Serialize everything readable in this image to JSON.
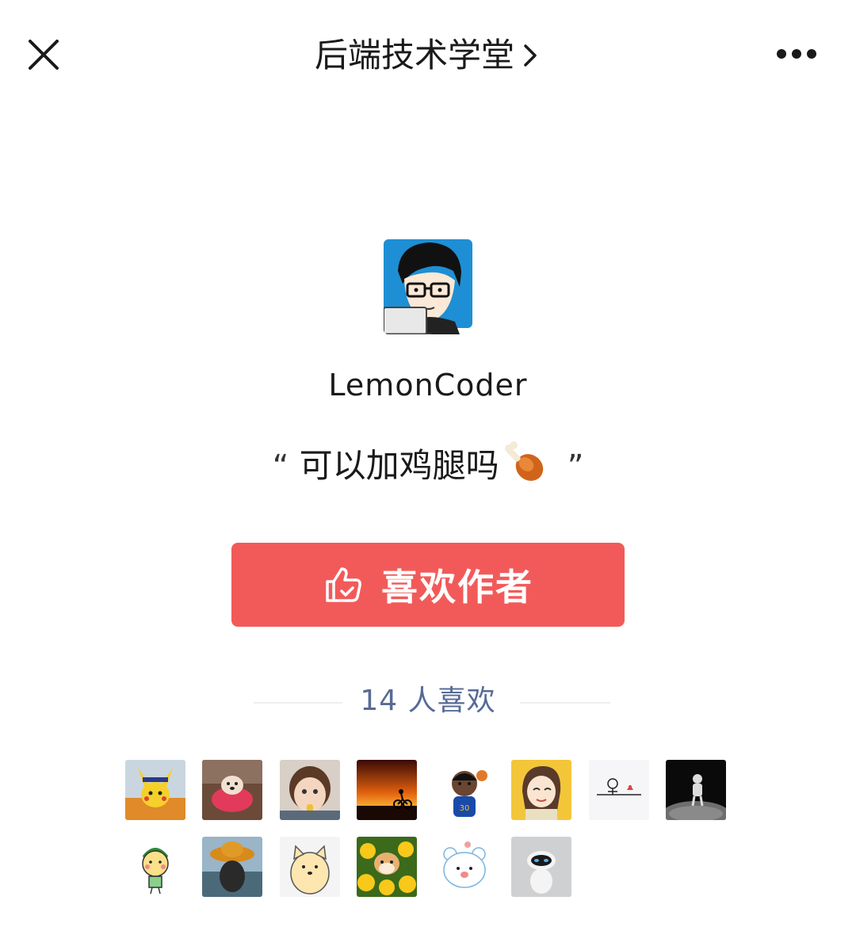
{
  "header": {
    "title": "后端技术学堂"
  },
  "author": {
    "name": "LemonCoder",
    "quote": "可以加鸡腿吗",
    "quote_open": "“",
    "quote_close": "”"
  },
  "like_button": {
    "label": "喜欢作者"
  },
  "likes": {
    "summary": "14 人喜欢",
    "count": 14
  },
  "colors": {
    "accent_red": "#f25a5a",
    "link_blue": "#576b95"
  },
  "likers": [
    {
      "avatar": "pikachu-avatar"
    },
    {
      "avatar": "dog-in-bucket-avatar"
    },
    {
      "avatar": "toddler-avatar"
    },
    {
      "avatar": "sunset-cyclist-avatar"
    },
    {
      "avatar": "cartoon-basketball-avatar"
    },
    {
      "avatar": "cartoon-girl-avatar"
    },
    {
      "avatar": "sketch-line-avatar"
    },
    {
      "avatar": "astronaut-avatar"
    },
    {
      "avatar": "cartoon-boy-avatar"
    },
    {
      "avatar": "hat-person-avatar"
    },
    {
      "avatar": "shiba-cartoon-avatar"
    },
    {
      "avatar": "shiba-sunflower-avatar"
    },
    {
      "avatar": "white-bear-avatar"
    },
    {
      "avatar": "robot-avatar"
    }
  ]
}
